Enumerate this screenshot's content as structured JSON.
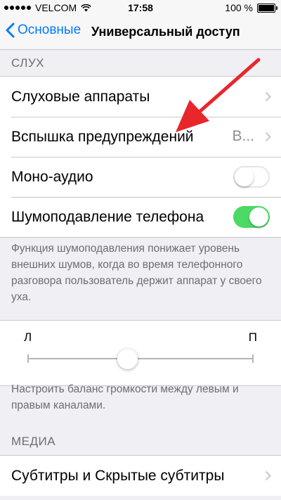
{
  "status_bar": {
    "carrier": "VELCOM",
    "time": "17:58",
    "battery_percent": "100 %",
    "battery_level": 1.0
  },
  "nav": {
    "back_label": "Основные",
    "title": "Универсальный доступ"
  },
  "hearing": {
    "header": "СЛУХ",
    "cells": {
      "hearing_aids": "Слуховые аппараты",
      "led_flash": "Вспышка предупреждений",
      "led_flash_value": "В...",
      "mono_audio": "Моно-аудио",
      "noise_cancellation": "Шумоподавление телефона"
    },
    "toggles": {
      "mono_audio": false,
      "noise_cancellation": true
    },
    "noise_footer": "Функция шумоподавления понижает уровень внешних шумов, когда во время телефонного разговора пользователь держит аппарат у своего уха."
  },
  "balance": {
    "left_label": "Л",
    "right_label": "П",
    "value": 0.44,
    "footer": "Настроить баланс громкости между левым и правым каналами."
  },
  "media": {
    "header": "МЕДИА",
    "subtitles": "Субтитры и Скрытые субтитры"
  },
  "colors": {
    "accent": "#007aff",
    "switch_on": "#4cd964",
    "arrow": "#e8262b"
  },
  "icons": [
    "signal-dots-icon",
    "wifi-icon",
    "battery-icon",
    "chevron-left-icon",
    "chevron-right-icon",
    "red-arrow-annotation"
  ]
}
